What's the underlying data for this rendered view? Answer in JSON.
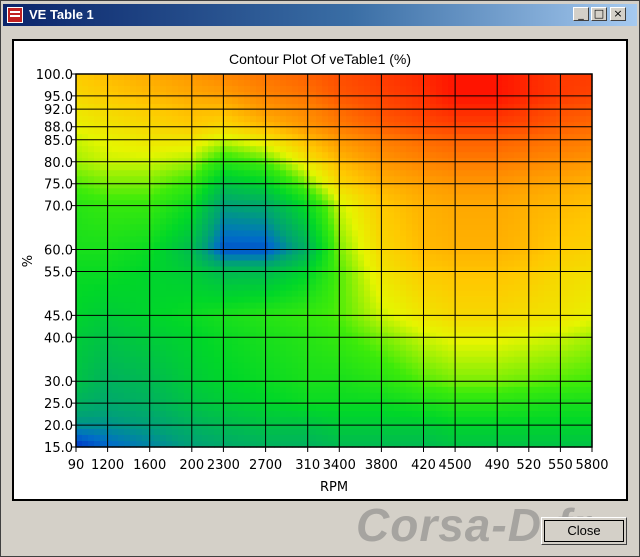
{
  "window": {
    "title": "VE Table 1",
    "minimize_glyph": "_",
    "maximize_glyph": "□",
    "close_glyph": "×"
  },
  "buttons": {
    "close_label": "Close"
  },
  "watermark": {
    "text": "Corsa-D.fr"
  },
  "colors": {
    "titlebar_start": "#0a246a",
    "titlebar_end": "#a6caf0",
    "face": "#d4d0c8",
    "low": "#0033cc",
    "mid": "#00e000",
    "high": "#ff0000"
  },
  "chart_data": {
    "type": "heatmap",
    "title": "Contour Plot Of veTable1 (%)",
    "xlabel": "RPM",
    "ylabel": "%",
    "x_ticks": [
      "90",
      "1200",
      "1600",
      "200",
      "2300",
      "2700",
      "310",
      "3400",
      "3800",
      "420",
      "4500",
      "490",
      "520",
      "550",
      "5800"
    ],
    "x": [
      900,
      1200,
      1600,
      2000,
      2300,
      2700,
      3100,
      3400,
      3800,
      4200,
      4500,
      4900,
      5200,
      5500,
      5800
    ],
    "y_ticks": [
      "100.0",
      "95.0",
      "92.0",
      "88.0",
      "85.0",
      "80.0",
      "75.0",
      "70.0",
      "60.0",
      "55.0",
      "45.0",
      "40.0",
      "30.0",
      "25.0",
      "20.0",
      "15.0"
    ],
    "y": [
      100,
      95,
      92,
      88,
      85,
      80,
      75,
      70,
      60,
      55,
      45,
      40,
      30,
      25,
      20,
      15
    ],
    "xlim": [
      900,
      5800
    ],
    "ylim": [
      15,
      100
    ],
    "zlim": [
      20,
      90
    ],
    "z": [
      [
        70,
        72,
        74,
        76,
        78,
        80,
        82,
        84,
        86,
        88,
        90,
        90,
        88,
        86,
        86
      ],
      [
        68,
        70,
        72,
        74,
        75,
        78,
        80,
        83,
        85,
        87,
        90,
        90,
        88,
        86,
        85
      ],
      [
        66,
        68,
        70,
        72,
        72,
        76,
        78,
        81,
        84,
        86,
        88,
        88,
        86,
        84,
        83
      ],
      [
        64,
        66,
        68,
        70,
        68,
        72,
        76,
        79,
        82,
        84,
        85,
        85,
        84,
        82,
        81
      ],
      [
        62,
        64,
        66,
        66,
        62,
        66,
        72,
        76,
        79,
        81,
        82,
        82,
        81,
        80,
        79
      ],
      [
        60,
        62,
        62,
        60,
        52,
        56,
        66,
        72,
        76,
        78,
        79,
        79,
        78,
        77,
        76
      ],
      [
        56,
        58,
        58,
        54,
        42,
        46,
        58,
        68,
        73,
        75,
        76,
        76,
        75,
        74,
        73
      ],
      [
        52,
        54,
        54,
        48,
        34,
        36,
        48,
        62,
        70,
        73,
        74,
        74,
        73,
        72,
        71
      ],
      [
        50,
        50,
        48,
        40,
        24,
        24,
        38,
        58,
        68,
        72,
        73,
        73,
        72,
        70,
        69
      ],
      [
        48,
        48,
        46,
        44,
        40,
        40,
        46,
        56,
        66,
        70,
        71,
        71,
        70,
        68,
        67
      ],
      [
        46,
        44,
        46,
        48,
        50,
        52,
        54,
        56,
        62,
        66,
        68,
        68,
        67,
        66,
        64
      ],
      [
        44,
        42,
        44,
        46,
        48,
        50,
        52,
        54,
        58,
        62,
        64,
        64,
        63,
        62,
        60
      ],
      [
        42,
        38,
        40,
        44,
        46,
        48,
        50,
        50,
        52,
        56,
        58,
        58,
        57,
        56,
        55
      ],
      [
        38,
        36,
        38,
        42,
        44,
        46,
        48,
        48,
        48,
        50,
        52,
        52,
        51,
        50,
        50
      ],
      [
        32,
        32,
        34,
        38,
        40,
        42,
        42,
        44,
        44,
        44,
        46,
        46,
        46,
        46,
        46
      ],
      [
        20,
        26,
        30,
        34,
        36,
        38,
        38,
        40,
        40,
        40,
        42,
        42,
        42,
        42,
        42
      ]
    ]
  }
}
